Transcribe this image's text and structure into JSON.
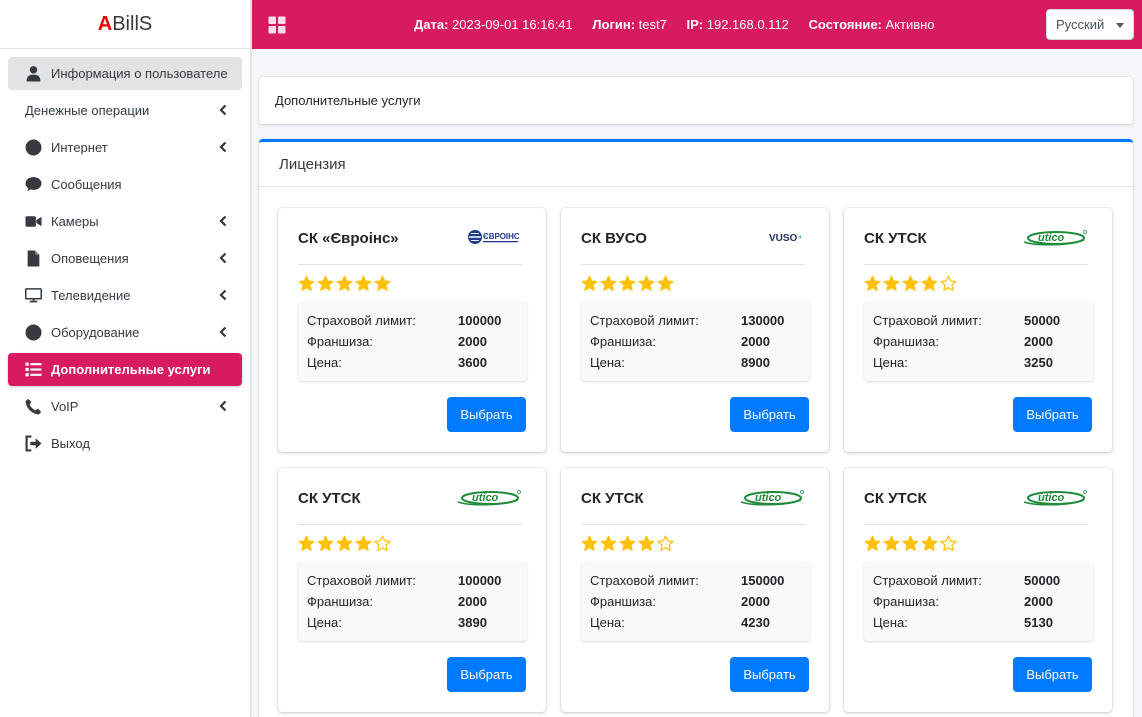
{
  "brand": {
    "first": "A",
    "rest": "BillS"
  },
  "topbar": {
    "date_label": "Дата:",
    "date_value": "2023-09-01 16:16:41",
    "login_label": "Логин:",
    "login_value": "test7",
    "ip_label": "IP:",
    "ip_value": "192.168.0.112",
    "state_label": "Состояние:",
    "state_value": "Активно",
    "language": "Русский"
  },
  "sidebar": {
    "items": [
      {
        "label": "Информация о пользователе",
        "icon": "user-icon",
        "chevron": false
      },
      {
        "label": "Денежные операции",
        "icon": "",
        "chevron": true
      },
      {
        "label": "Интернет",
        "icon": "circle-icon",
        "chevron": true
      },
      {
        "label": "Сообщения",
        "icon": "chat-icon",
        "chevron": false
      },
      {
        "label": "Камеры",
        "icon": "video-icon",
        "chevron": true
      },
      {
        "label": "Оповещения",
        "icon": "file-icon",
        "chevron": true
      },
      {
        "label": "Телевидение",
        "icon": "monitor-icon",
        "chevron": true
      },
      {
        "label": "Оборудование",
        "icon": "circle-icon",
        "chevron": true
      },
      {
        "label": "Дополнительные услуги",
        "icon": "list-icon",
        "chevron": false
      },
      {
        "label": "VoIP",
        "icon": "phone-icon",
        "chevron": true
      },
      {
        "label": "Выход",
        "icon": "logout-icon",
        "chevron": false
      }
    ]
  },
  "breadcrumb": "Дополнительные услуги",
  "section_title": "Лицензия",
  "labels": {
    "limit": "Страховой лимит:",
    "franchise": "Франшиза:",
    "price": "Цена:",
    "select": "Выбрать"
  },
  "colors": {
    "accent": "#d81b60",
    "primary": "#007bff",
    "star": "#ffc107"
  },
  "offers": [
    {
      "name": "СК «Євроінс»",
      "logo": "euroins-logo",
      "rating": 5,
      "limit": "100000",
      "franchise": "2000",
      "price": "3600"
    },
    {
      "name": "СК ВУСО",
      "logo": "vuso-logo",
      "rating": 5,
      "limit": "130000",
      "franchise": "2000",
      "price": "8900"
    },
    {
      "name": "СК УТСК",
      "logo": "utico-logo",
      "rating": 4,
      "limit": "50000",
      "franchise": "2000",
      "price": "3250"
    },
    {
      "name": "СК УТСК",
      "logo": "utico-logo",
      "rating": 4,
      "limit": "100000",
      "franchise": "2000",
      "price": "3890"
    },
    {
      "name": "СК УТСК",
      "logo": "utico-logo",
      "rating": 4,
      "limit": "150000",
      "franchise": "2000",
      "price": "4230"
    },
    {
      "name": "СК УТСК",
      "logo": "utico-logo",
      "rating": 4,
      "limit": "50000",
      "franchise": "2000",
      "price": "5130"
    }
  ]
}
